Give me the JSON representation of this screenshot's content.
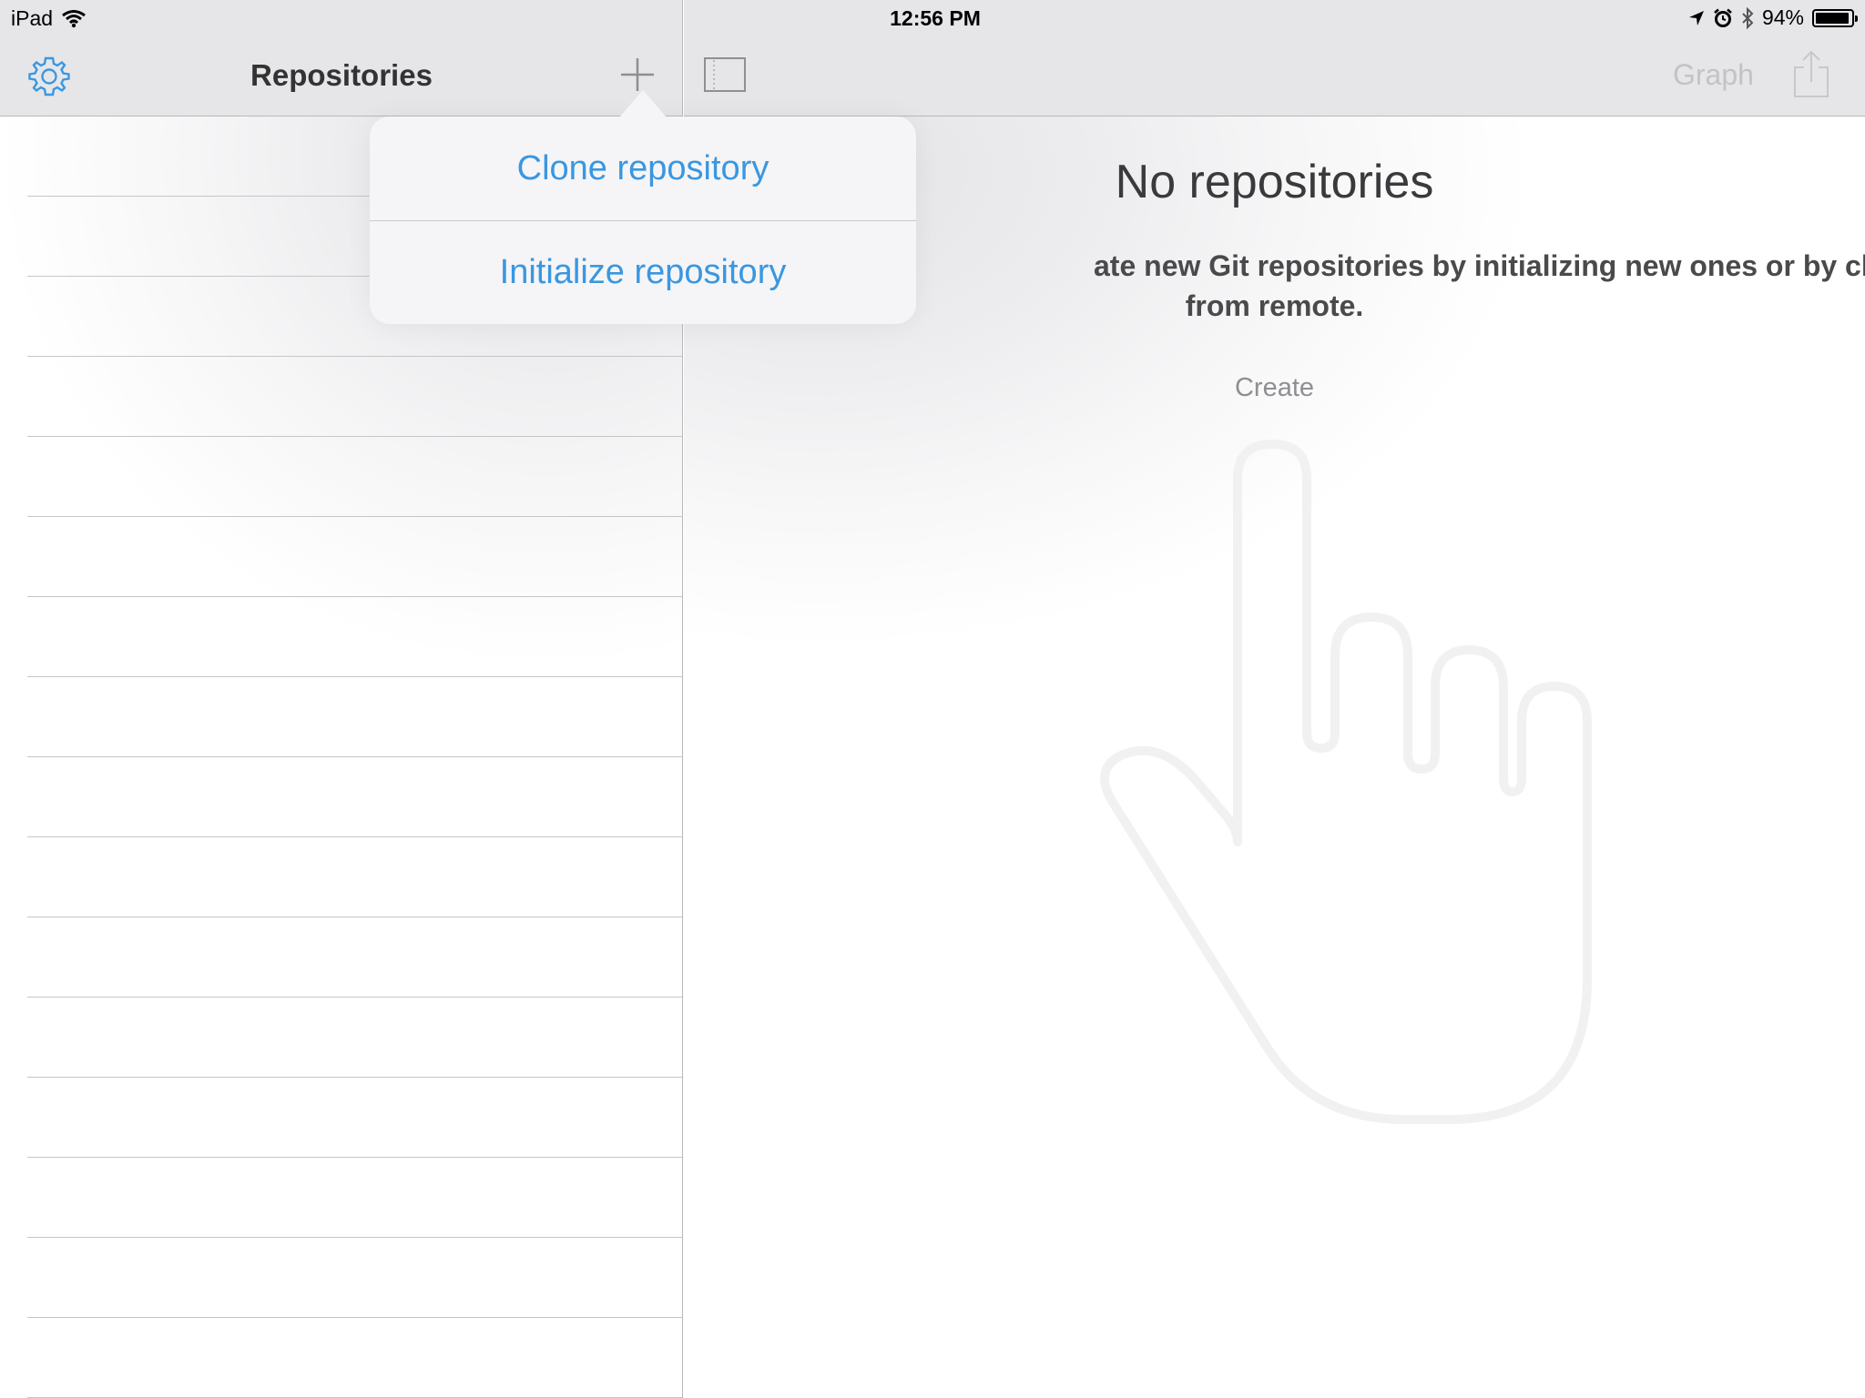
{
  "status_bar": {
    "carrier": "iPad",
    "time": "12:56 PM",
    "battery": "94%",
    "battery_level": 0.94,
    "icons": [
      "wifi-icon",
      "location-icon",
      "alarm-icon",
      "bluetooth-icon",
      "battery-icon"
    ]
  },
  "master": {
    "title": "Repositories",
    "settings_icon": "gear-icon",
    "add_icon": "plus-icon",
    "row_count": 16
  },
  "popover": {
    "items": [
      {
        "label": "Clone repository"
      },
      {
        "label": "Initialize repository"
      }
    ]
  },
  "detail": {
    "sidebar_icon": "sidebar-toggle-icon",
    "graph_label": "Graph",
    "share_icon": "share-icon",
    "empty_title": "No repositories",
    "empty_line1": "ate new Git repositories by initializing new ones or by cloning",
    "empty_line2": "from remote.",
    "create_label": "Create",
    "illustration": "hand-pointer-icon"
  },
  "colors": {
    "accent": "#3a97e0",
    "nav_background": "#e6e6e9",
    "popover_background": "#f5f5f7"
  }
}
